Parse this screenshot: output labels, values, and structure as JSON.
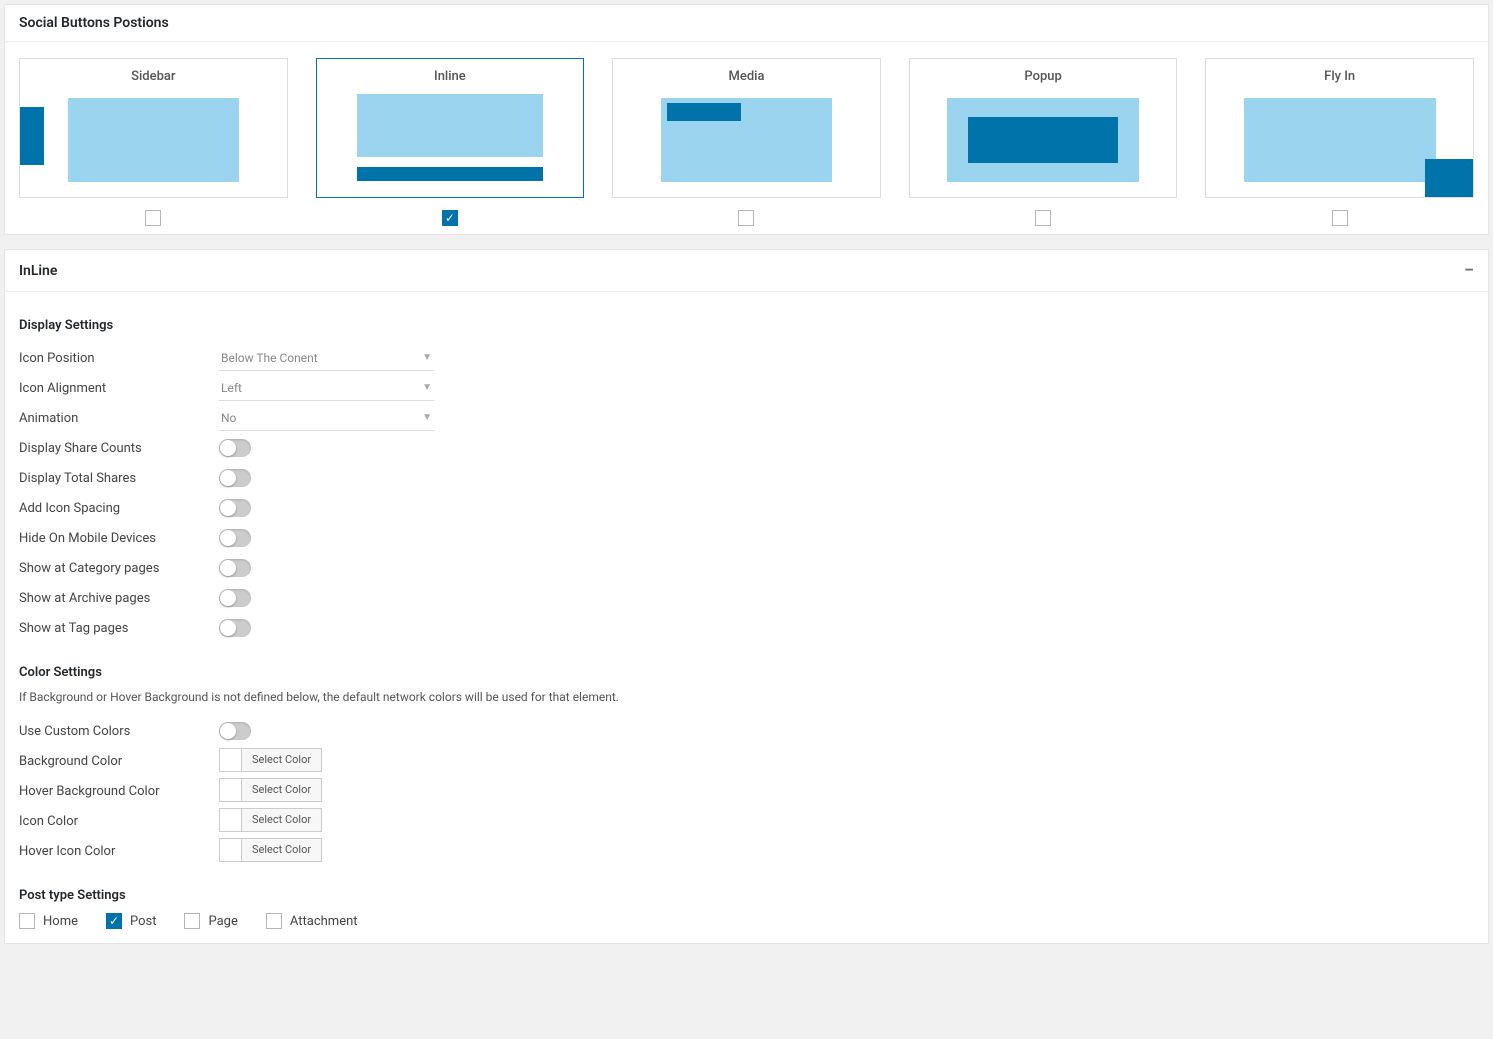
{
  "positions_panel": {
    "title": "Social Buttons Postions",
    "items": [
      {
        "label": "Sidebar",
        "checked": false
      },
      {
        "label": "Inline",
        "checked": true
      },
      {
        "label": "Media",
        "checked": false
      },
      {
        "label": "Popup",
        "checked": false
      },
      {
        "label": "Fly In",
        "checked": false
      }
    ]
  },
  "inline_panel": {
    "title": "InLine",
    "display_settings": {
      "title": "Display Settings",
      "rows": {
        "icon_position": {
          "label": "Icon Position",
          "value": "Below The Conent"
        },
        "icon_alignment": {
          "label": "Icon Alignment",
          "value": "Left"
        },
        "animation": {
          "label": "Animation",
          "value": "No"
        },
        "display_share_counts": {
          "label": "Display Share Counts",
          "on": false
        },
        "display_total_shares": {
          "label": "Display Total Shares",
          "on": false
        },
        "add_icon_spacing": {
          "label": "Add Icon Spacing",
          "on": false
        },
        "hide_on_mobile": {
          "label": "Hide On Mobile Devices",
          "on": false
        },
        "show_category": {
          "label": "Show at Category pages",
          "on": false
        },
        "show_archive": {
          "label": "Show at Archive pages",
          "on": false
        },
        "show_tag": {
          "label": "Show at Tag pages",
          "on": false
        }
      }
    },
    "color_settings": {
      "title": "Color Settings",
      "desc": "If Background or Hover Background is not defined below, the default network colors will be used for that element.",
      "use_custom_colors": {
        "label": "Use Custom Colors",
        "on": false
      },
      "select_label": "Select Color",
      "rows": {
        "background": {
          "label": "Background Color"
        },
        "hover_background": {
          "label": "Hover Background Color"
        },
        "icon": {
          "label": "Icon Color"
        },
        "hover_icon": {
          "label": "Hover Icon Color"
        }
      }
    },
    "post_type_settings": {
      "title": "Post type Settings",
      "items": [
        {
          "label": "Home",
          "checked": false
        },
        {
          "label": "Post",
          "checked": true
        },
        {
          "label": "Page",
          "checked": false
        },
        {
          "label": "Attachment",
          "checked": false
        }
      ]
    }
  }
}
